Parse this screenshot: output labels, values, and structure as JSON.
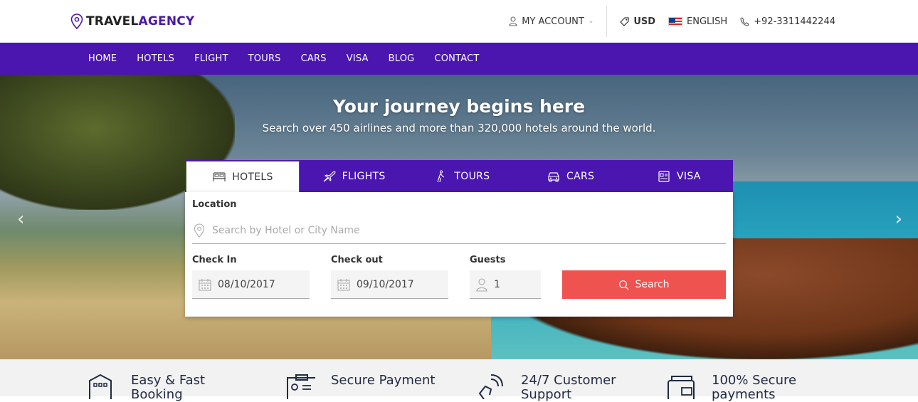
{
  "brand": {
    "name_part1": "TRAVEL",
    "name_part2": "AGENCY",
    "accent": "#4b15b0"
  },
  "topbar": {
    "account_label": "MY ACCOUNT",
    "currency": "USD",
    "language": "ENGLISH",
    "phone": "+92-3311442244"
  },
  "nav": {
    "items": [
      "HOME",
      "HOTELS",
      "FLIGHT",
      "TOURS",
      "CARS",
      "VISA",
      "BLOG",
      "CONTACT"
    ]
  },
  "hero": {
    "title": "Your journey begins here",
    "subtitle": "Search over 450 airlines and more than 320,000 hotels around the world."
  },
  "search": {
    "tabs": [
      {
        "label": "HOTELS",
        "icon": "bed-icon",
        "active": true
      },
      {
        "label": "FLIGHTS",
        "icon": "plane-icon",
        "active": false
      },
      {
        "label": "TOURS",
        "icon": "hiker-icon",
        "active": false
      },
      {
        "label": "CARS",
        "icon": "car-icon",
        "active": false
      },
      {
        "label": "VISA",
        "icon": "passport-icon",
        "active": false
      }
    ],
    "location_label": "Location",
    "location_placeholder": "Search by Hotel or City Name",
    "checkin_label": "Check In",
    "checkin_value": "08/10/2017",
    "checkout_label": "Check out",
    "checkout_value": "09/10/2017",
    "guests_label": "Guests",
    "guests_value": "1",
    "search_button": "Search",
    "button_color": "#ef5350"
  },
  "features": [
    {
      "title": "Easy & Fast Booking",
      "icon": "building-icon"
    },
    {
      "title": "Secure Payment",
      "icon": "id-card-icon"
    },
    {
      "title": "24/7 Customer Support",
      "icon": "phone-icon"
    },
    {
      "title": "100% Secure payments",
      "icon": "wallet-icon"
    }
  ]
}
